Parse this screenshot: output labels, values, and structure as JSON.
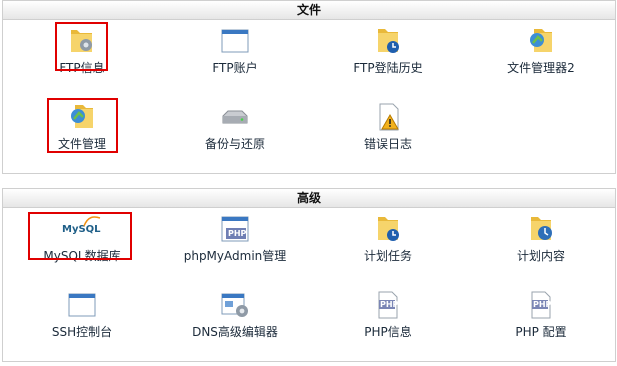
{
  "sections": {
    "files": {
      "title": "文件",
      "items": [
        {
          "label": "FTP信息",
          "icon": "folder-gear-icon"
        },
        {
          "label": "FTP账户",
          "icon": "window-icon"
        },
        {
          "label": "FTP登陆历史",
          "icon": "folder-clock-icon"
        },
        {
          "label": "文件管理器2",
          "icon": "file-manager-icon"
        },
        {
          "label": "文件管理",
          "icon": "file-manager-icon"
        },
        {
          "label": "备份与还原",
          "icon": "disk-drive-icon"
        },
        {
          "label": "错误日志",
          "icon": "warning-log-icon"
        }
      ]
    },
    "advanced": {
      "title": "高级",
      "items": [
        {
          "label": "MySQL数据库",
          "icon": "mysql-logo-icon",
          "logo_text": "MySQL"
        },
        {
          "label": "phpMyAdmin管理",
          "icon": "php-window-icon",
          "badge": "PHP"
        },
        {
          "label": "计划任务",
          "icon": "folder-clock-icon"
        },
        {
          "label": "计划内容",
          "icon": "folder-clock-icon"
        },
        {
          "label": "SSH控制台",
          "icon": "window-icon"
        },
        {
          "label": "DNS高级编辑器",
          "icon": "dns-editor-icon"
        },
        {
          "label": "PHP信息",
          "icon": "php-file-icon",
          "badge": "PHP"
        },
        {
          "label": "PHP 配置",
          "icon": "php-file-icon",
          "badge": "PHP"
        }
      ]
    }
  },
  "colors": {
    "highlight": "#e00000",
    "folder": "#f2c94c",
    "accent_blue": "#2f6fb8",
    "label": "#1b2a3a"
  }
}
